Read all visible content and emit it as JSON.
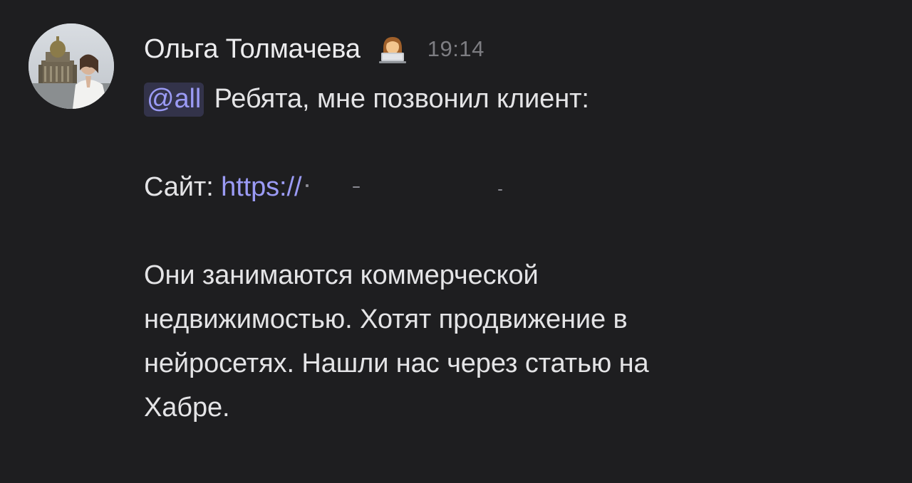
{
  "message": {
    "author": "Ольга Толмачева",
    "author_status_icon": "woman-technologist-emoji",
    "timestamp": "19:14",
    "mention": "@all",
    "intro_text": " Ребята, мне позвонил клиент:",
    "site_label": "Сайт: ",
    "site_link": "https://",
    "paragraph_lines": [
      "Они занимаются коммерческой",
      "недвижимостью. Хотят продвижение в",
      "нейросетях. Нашли нас через статью на",
      "Хабре."
    ]
  },
  "colors": {
    "background": "#1e1e20",
    "text": "#e4e4e6",
    "mention_bg": "#33334a",
    "link": "#9b9bf5",
    "timestamp": "#7d7d82"
  }
}
